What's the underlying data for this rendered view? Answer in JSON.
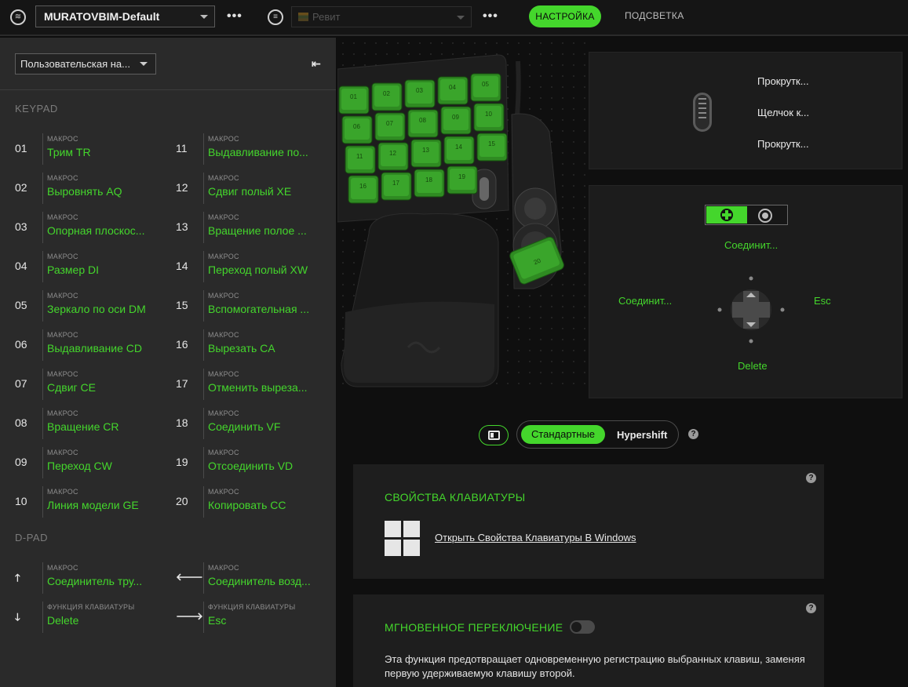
{
  "topbar": {
    "profile_name": "MURATOVBIM-Default",
    "more_label": "•••",
    "app_name": "Ревит",
    "tab_settings": "НАСТРОЙКА",
    "tab_lighting": "ПОДСВЕТКА"
  },
  "sidebar": {
    "config_name": "Пользовательская на...",
    "keypad_title": "KEYPAD",
    "dpad_title": "D-PAD",
    "keys_left": [
      {
        "num": "01",
        "type": "МАКРОС",
        "name": "Трим TR"
      },
      {
        "num": "02",
        "type": "МАКРОС",
        "name": "Выровнять AQ"
      },
      {
        "num": "03",
        "type": "МАКРОС",
        "name": "Опорная плоскос..."
      },
      {
        "num": "04",
        "type": "МАКРОС",
        "name": "Размер DI"
      },
      {
        "num": "05",
        "type": "МАКРОС",
        "name": "Зеркало по оси DM"
      },
      {
        "num": "06",
        "type": "МАКРОС",
        "name": "Выдавливание CD"
      },
      {
        "num": "07",
        "type": "МАКРОС",
        "name": "Сдвиг CE"
      },
      {
        "num": "08",
        "type": "МАКРОС",
        "name": "Вращение CR"
      },
      {
        "num": "09",
        "type": "МАКРОС",
        "name": "Переход CW"
      },
      {
        "num": "10",
        "type": "МАКРОС",
        "name": "Линия модели GE"
      }
    ],
    "keys_right": [
      {
        "num": "11",
        "type": "МАКРОС",
        "name": "Выдавливание по..."
      },
      {
        "num": "12",
        "type": "МАКРОС",
        "name": "Сдвиг полый XE"
      },
      {
        "num": "13",
        "type": "МАКРОС",
        "name": "Вращение полое ..."
      },
      {
        "num": "14",
        "type": "МАКРОС",
        "name": "Переход полый XW"
      },
      {
        "num": "15",
        "type": "МАКРОС",
        "name": "Вспомогательная ..."
      },
      {
        "num": "16",
        "type": "МАКРОС",
        "name": "Вырезать CA"
      },
      {
        "num": "17",
        "type": "МАКРОС",
        "name": "Отменить выреза..."
      },
      {
        "num": "18",
        "type": "МАКРОС",
        "name": "Соединить VF"
      },
      {
        "num": "19",
        "type": "МАКРОС",
        "name": "Отсоединить VD"
      },
      {
        "num": "20",
        "type": "МАКРОС",
        "name": "Копировать CC"
      }
    ],
    "dpad": [
      {
        "arrow": "🡑",
        "type": "МАКРОС",
        "name": "Соединитель тру..."
      },
      {
        "arrow": "🡐",
        "type": "МАКРОС",
        "name": "Соединитель возд..."
      },
      {
        "arrow": "🡓",
        "type": "ФУНКЦИЯ КЛАВИАТУРЫ",
        "name": "Delete"
      },
      {
        "arrow": "🡒",
        "type": "ФУНКЦИЯ КЛАВИАТУРЫ",
        "name": "Esc"
      }
    ]
  },
  "device": {
    "key_labels": [
      "01",
      "02",
      "03",
      "04",
      "05",
      "06",
      "07",
      "08",
      "09",
      "10",
      "11",
      "12",
      "13",
      "14",
      "15",
      "16",
      "17",
      "18",
      "19",
      "20"
    ]
  },
  "mouse_panel": {
    "scroll_up": "Прокрутк...",
    "click": "Щелчок к...",
    "scroll_down": "Прокрутк..."
  },
  "dpad_panel": {
    "up": "Соединит...",
    "left": "Соединит...",
    "right": "Esc",
    "down": "Delete"
  },
  "mode": {
    "standard": "Стандартные",
    "hypershift": "Hypershift",
    "help": "?"
  },
  "keyboard_props": {
    "title": "СВОЙСТВА КЛАВИАТУРЫ",
    "link": "Открыть Свойства Клавиатуры В Windows"
  },
  "snap_tap": {
    "title": "МГНОВЕННОЕ ПЕРЕКЛЮЧЕНИЕ",
    "description": "Эта функция предотвращает одновременную регистрацию выбранных клавиш, заменяя первую удерживаемую клавишу второй.",
    "enabled": false
  },
  "colors": {
    "accent": "#44d62c",
    "sidebar_bg": "#2a2a2a",
    "panel_bg": "#1c1c1c"
  }
}
